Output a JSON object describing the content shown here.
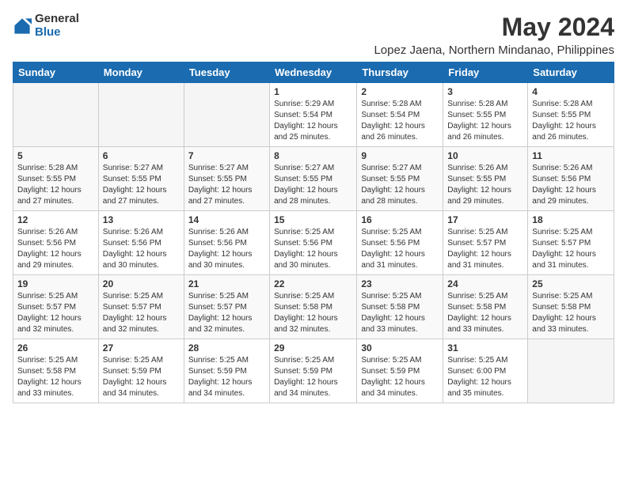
{
  "logo": {
    "general": "General",
    "blue": "Blue"
  },
  "title": "May 2024",
  "subtitle": "Lopez Jaena, Northern Mindanao, Philippines",
  "days_of_week": [
    "Sunday",
    "Monday",
    "Tuesday",
    "Wednesday",
    "Thursday",
    "Friday",
    "Saturday"
  ],
  "weeks": [
    [
      {
        "day": "",
        "info": ""
      },
      {
        "day": "",
        "info": ""
      },
      {
        "day": "",
        "info": ""
      },
      {
        "day": "1",
        "info": "Sunrise: 5:29 AM\nSunset: 5:54 PM\nDaylight: 12 hours\nand 25 minutes."
      },
      {
        "day": "2",
        "info": "Sunrise: 5:28 AM\nSunset: 5:54 PM\nDaylight: 12 hours\nand 26 minutes."
      },
      {
        "day": "3",
        "info": "Sunrise: 5:28 AM\nSunset: 5:55 PM\nDaylight: 12 hours\nand 26 minutes."
      },
      {
        "day": "4",
        "info": "Sunrise: 5:28 AM\nSunset: 5:55 PM\nDaylight: 12 hours\nand 26 minutes."
      }
    ],
    [
      {
        "day": "5",
        "info": "Sunrise: 5:28 AM\nSunset: 5:55 PM\nDaylight: 12 hours\nand 27 minutes."
      },
      {
        "day": "6",
        "info": "Sunrise: 5:27 AM\nSunset: 5:55 PM\nDaylight: 12 hours\nand 27 minutes."
      },
      {
        "day": "7",
        "info": "Sunrise: 5:27 AM\nSunset: 5:55 PM\nDaylight: 12 hours\nand 27 minutes."
      },
      {
        "day": "8",
        "info": "Sunrise: 5:27 AM\nSunset: 5:55 PM\nDaylight: 12 hours\nand 28 minutes."
      },
      {
        "day": "9",
        "info": "Sunrise: 5:27 AM\nSunset: 5:55 PM\nDaylight: 12 hours\nand 28 minutes."
      },
      {
        "day": "10",
        "info": "Sunrise: 5:26 AM\nSunset: 5:55 PM\nDaylight: 12 hours\nand 29 minutes."
      },
      {
        "day": "11",
        "info": "Sunrise: 5:26 AM\nSunset: 5:56 PM\nDaylight: 12 hours\nand 29 minutes."
      }
    ],
    [
      {
        "day": "12",
        "info": "Sunrise: 5:26 AM\nSunset: 5:56 PM\nDaylight: 12 hours\nand 29 minutes."
      },
      {
        "day": "13",
        "info": "Sunrise: 5:26 AM\nSunset: 5:56 PM\nDaylight: 12 hours\nand 30 minutes."
      },
      {
        "day": "14",
        "info": "Sunrise: 5:26 AM\nSunset: 5:56 PM\nDaylight: 12 hours\nand 30 minutes."
      },
      {
        "day": "15",
        "info": "Sunrise: 5:25 AM\nSunset: 5:56 PM\nDaylight: 12 hours\nand 30 minutes."
      },
      {
        "day": "16",
        "info": "Sunrise: 5:25 AM\nSunset: 5:56 PM\nDaylight: 12 hours\nand 31 minutes."
      },
      {
        "day": "17",
        "info": "Sunrise: 5:25 AM\nSunset: 5:57 PM\nDaylight: 12 hours\nand 31 minutes."
      },
      {
        "day": "18",
        "info": "Sunrise: 5:25 AM\nSunset: 5:57 PM\nDaylight: 12 hours\nand 31 minutes."
      }
    ],
    [
      {
        "day": "19",
        "info": "Sunrise: 5:25 AM\nSunset: 5:57 PM\nDaylight: 12 hours\nand 32 minutes."
      },
      {
        "day": "20",
        "info": "Sunrise: 5:25 AM\nSunset: 5:57 PM\nDaylight: 12 hours\nand 32 minutes."
      },
      {
        "day": "21",
        "info": "Sunrise: 5:25 AM\nSunset: 5:57 PM\nDaylight: 12 hours\nand 32 minutes."
      },
      {
        "day": "22",
        "info": "Sunrise: 5:25 AM\nSunset: 5:58 PM\nDaylight: 12 hours\nand 32 minutes."
      },
      {
        "day": "23",
        "info": "Sunrise: 5:25 AM\nSunset: 5:58 PM\nDaylight: 12 hours\nand 33 minutes."
      },
      {
        "day": "24",
        "info": "Sunrise: 5:25 AM\nSunset: 5:58 PM\nDaylight: 12 hours\nand 33 minutes."
      },
      {
        "day": "25",
        "info": "Sunrise: 5:25 AM\nSunset: 5:58 PM\nDaylight: 12 hours\nand 33 minutes."
      }
    ],
    [
      {
        "day": "26",
        "info": "Sunrise: 5:25 AM\nSunset: 5:58 PM\nDaylight: 12 hours\nand 33 minutes."
      },
      {
        "day": "27",
        "info": "Sunrise: 5:25 AM\nSunset: 5:59 PM\nDaylight: 12 hours\nand 34 minutes."
      },
      {
        "day": "28",
        "info": "Sunrise: 5:25 AM\nSunset: 5:59 PM\nDaylight: 12 hours\nand 34 minutes."
      },
      {
        "day": "29",
        "info": "Sunrise: 5:25 AM\nSunset: 5:59 PM\nDaylight: 12 hours\nand 34 minutes."
      },
      {
        "day": "30",
        "info": "Sunrise: 5:25 AM\nSunset: 5:59 PM\nDaylight: 12 hours\nand 34 minutes."
      },
      {
        "day": "31",
        "info": "Sunrise: 5:25 AM\nSunset: 6:00 PM\nDaylight: 12 hours\nand 35 minutes."
      },
      {
        "day": "",
        "info": ""
      }
    ]
  ]
}
